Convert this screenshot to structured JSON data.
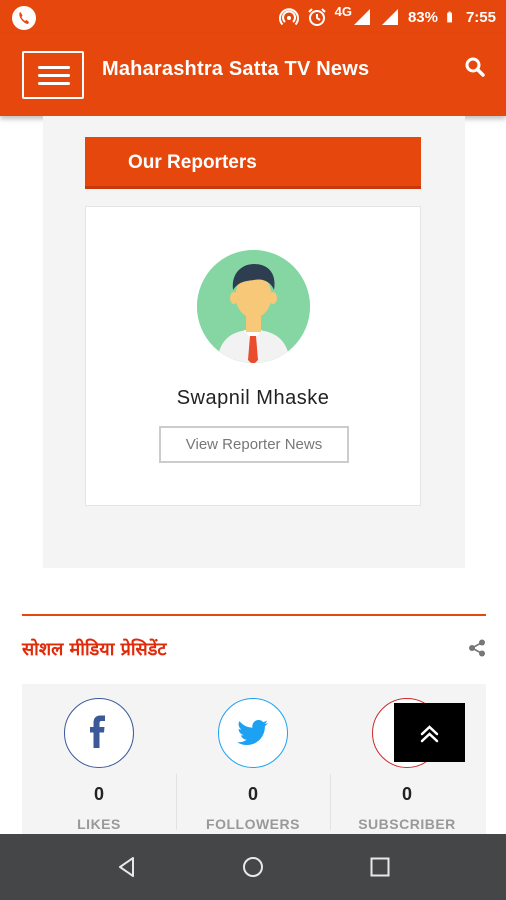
{
  "status_bar": {
    "network": "4G",
    "battery": "83%",
    "time": "7:55",
    "icons": [
      "phone-icon",
      "hotspot-icon",
      "alarm-icon",
      "signal-icon",
      "battery-icon"
    ]
  },
  "app_bar": {
    "title": "Maharashtra Satta TV News",
    "menu_icon": "hamburger-icon",
    "search_icon": "search-icon"
  },
  "reporters": {
    "heading": "Our Reporters",
    "items": [
      {
        "name": "Swapnil Mhaske",
        "button_label": "View Reporter News",
        "avatar": "reporter-avatar"
      }
    ]
  },
  "social": {
    "title": "सोशल मीडिया प्रेसिडेंट",
    "share_icon": "share-icon",
    "stats": [
      {
        "network": "facebook",
        "icon": "facebook-icon",
        "count": "0",
        "label": "LIKES",
        "color": "#3b5998"
      },
      {
        "network": "twitter",
        "icon": "twitter-icon",
        "count": "0",
        "label": "FOLLOWERS",
        "color": "#1da1f2"
      },
      {
        "network": "youtube",
        "icon": "youtube-icon",
        "count": "0",
        "label": "SUBSCRIBER",
        "color": "#cc2a2a"
      }
    ]
  },
  "scroll_top_icon": "chevron-up-double-icon",
  "nav_bar": {
    "back_icon": "back-icon",
    "home_icon": "home-icon",
    "recents_icon": "recents-icon"
  },
  "colors": {
    "brand": "#e6470c",
    "panel": "#f4f4f4",
    "nav": "#444648"
  }
}
